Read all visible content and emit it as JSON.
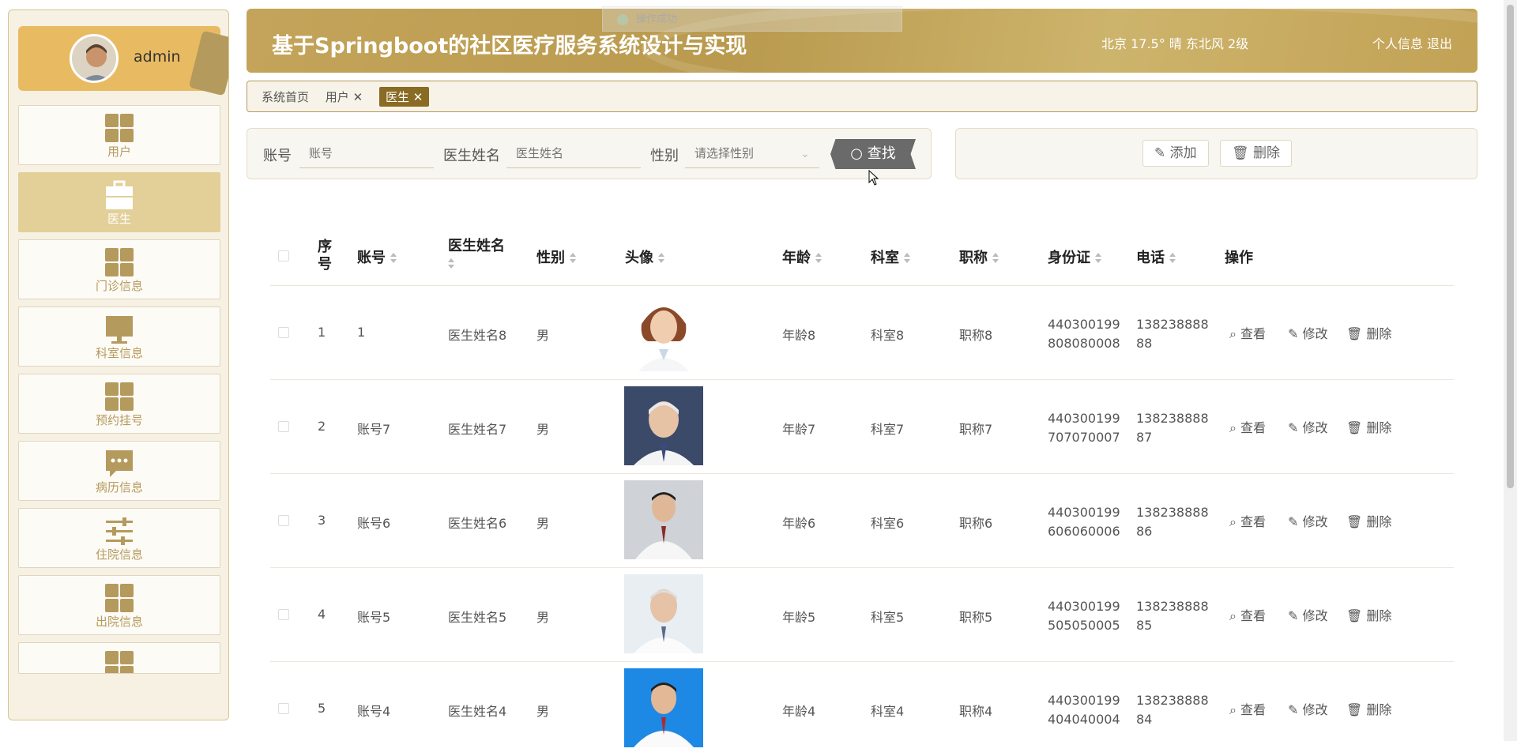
{
  "sidebar": {
    "user": {
      "name": "admin"
    },
    "items": [
      {
        "label": "用户",
        "icon": "grid-icon"
      },
      {
        "label": "医生",
        "icon": "briefcase-icon"
      },
      {
        "label": "门诊信息",
        "icon": "grid-icon"
      },
      {
        "label": "科室信息",
        "icon": "monitor-icon"
      },
      {
        "label": "预约挂号",
        "icon": "grid-icon"
      },
      {
        "label": "病历信息",
        "icon": "chat-icon"
      },
      {
        "label": "住院信息",
        "icon": "sliders-icon"
      },
      {
        "label": "出院信息",
        "icon": "grid-icon"
      },
      {
        "label": "",
        "icon": "grid-icon"
      }
    ],
    "active_index": 1
  },
  "header": {
    "title": "基于Springboot的社区医疗服务系统设计与实现",
    "weather": "北京  17.5°  晴  东北风  2级",
    "profile_link": "个人信息",
    "logout_link": "退出"
  },
  "toast": {
    "text": "操作成功"
  },
  "tabs": [
    {
      "label": "系统首页",
      "closable": false,
      "active": false
    },
    {
      "label": "用户",
      "closable": true,
      "active": false
    },
    {
      "label": "医生",
      "closable": true,
      "active": true
    }
  ],
  "search": {
    "account_label": "账号",
    "account_placeholder": "账号",
    "name_label": "医生姓名",
    "name_placeholder": "医生姓名",
    "gender_label": "性别",
    "gender_placeholder": "请选择性别",
    "find_button": "查找"
  },
  "actions": {
    "add_button": "添加",
    "delete_button": "删除"
  },
  "table": {
    "columns": [
      "序号",
      "账号",
      "医生姓名",
      "性别",
      "头像",
      "年龄",
      "科室",
      "职称",
      "身份证",
      "电话",
      "操作"
    ],
    "row_actions": {
      "view": "查看",
      "edit": "修改",
      "delete": "删除"
    },
    "rows": [
      {
        "index": "1",
        "account": "1",
        "name": "医生姓名8",
        "gender": "男",
        "age": "年龄8",
        "dept": "科室8",
        "title": "职称8",
        "id1": "440300199",
        "id2": "808080008",
        "phone1": "138238888",
        "phone2": "88"
      },
      {
        "index": "2",
        "account": "账号7",
        "name": "医生姓名7",
        "gender": "男",
        "age": "年龄7",
        "dept": "科室7",
        "title": "职称7",
        "id1": "440300199",
        "id2": "707070007",
        "phone1": "138238888",
        "phone2": "87"
      },
      {
        "index": "3",
        "account": "账号6",
        "name": "医生姓名6",
        "gender": "男",
        "age": "年龄6",
        "dept": "科室6",
        "title": "职称6",
        "id1": "440300199",
        "id2": "606060006",
        "phone1": "138238888",
        "phone2": "86"
      },
      {
        "index": "4",
        "account": "账号5",
        "name": "医生姓名5",
        "gender": "男",
        "age": "年龄5",
        "dept": "科室5",
        "title": "职称5",
        "id1": "440300199",
        "id2": "505050005",
        "phone1": "138238888",
        "phone2": "85"
      },
      {
        "index": "5",
        "account": "账号4",
        "name": "医生姓名4",
        "gender": "男",
        "age": "年龄4",
        "dept": "科室4",
        "title": "职称4",
        "id1": "440300199",
        "id2": "404040004",
        "phone1": "138238888",
        "phone2": "84"
      }
    ]
  },
  "colors": {
    "accent": "#b59a5d",
    "header": "#c4a45a",
    "active_tab": "#8a6b23",
    "find_button": "#6a6a6a"
  }
}
